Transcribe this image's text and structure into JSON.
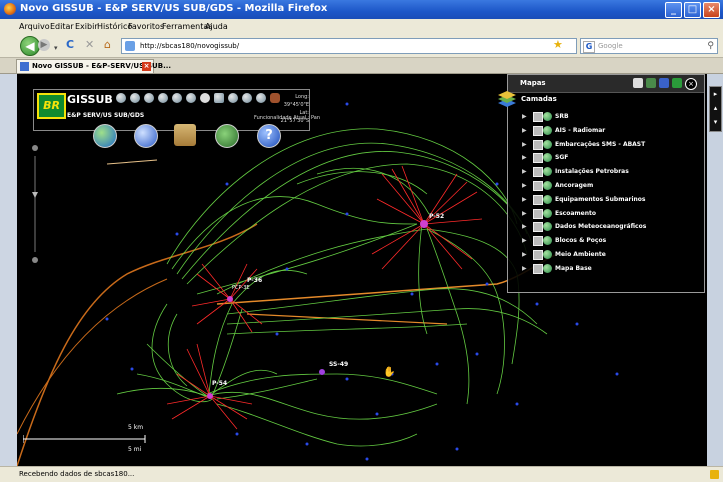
{
  "window": {
    "title": "Novo GISSUB - E&P SERV/US SUB/GDS - Mozilla Firefox"
  },
  "menu": [
    "Arquivo",
    "Editar",
    "Exibir",
    "Histórico",
    "Favoritos",
    "Ferramentas",
    "Ajuda"
  ],
  "nav": {
    "url": "http://sbcas180/novogissub/",
    "search_placeholder": "Google"
  },
  "tab": {
    "label": "Novo GISSUB - E&P-SERV/US-SUB..."
  },
  "app": {
    "logo": "BR",
    "title": "GISSUB",
    "subtitle": "E&P SERV/US SUB/GDS",
    "longitude": "Long: 39°45'0\"E",
    "latitude": "Lat: 21°57'30\"S",
    "functionality": "Funcionalidade Atual : Pan"
  },
  "map": {
    "platforms": [
      "P-52",
      "P-36",
      "P-54",
      "SS-49"
    ],
    "label_pcp": "PCP-3E",
    "scale_top": "5 km",
    "scale_bottom": "5 mi"
  },
  "maps_panel": {
    "title": "Mapas",
    "section": "Camadas",
    "layers": [
      "SRB",
      "AIS - Radiomar",
      "Embarcações SMS - ABAST",
      "SGF",
      "Instalações Petrobras",
      "Ancoragem",
      "Equipamentos Submarinos",
      "Escoamento",
      "Dados Meteoceanográficos",
      "Blocos & Poços",
      "Meio Ambiente",
      "Mapa Base"
    ]
  },
  "status": {
    "text": "Recebendo dados de sbcas180..."
  },
  "colors": {
    "track_green": "#6fe24a",
    "anchor_red": "#ff2a2a",
    "panel_bg": "#000000"
  }
}
